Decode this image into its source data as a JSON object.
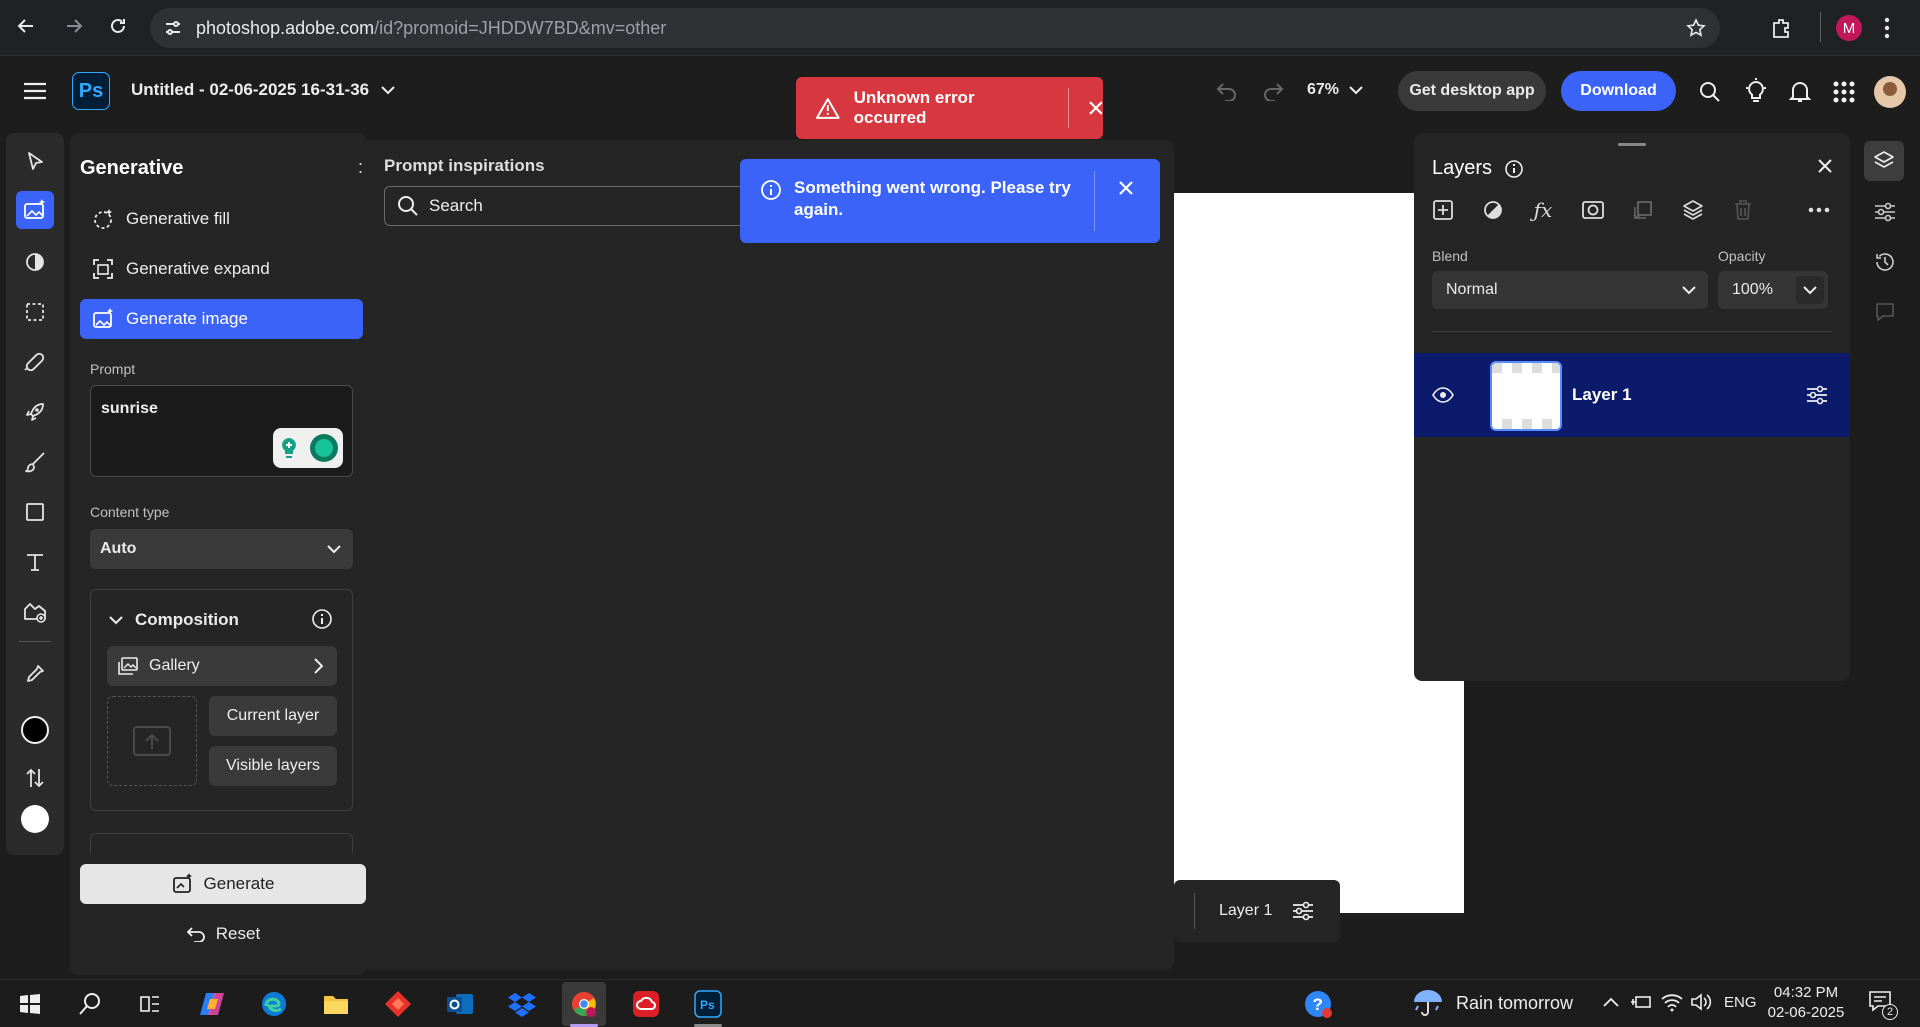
{
  "browser": {
    "url_host": "photoshop.adobe.com",
    "url_path": "/id?promoid=JHDDW7BD&mv=other",
    "profile_initial": "M"
  },
  "header": {
    "app_logo": "Ps",
    "doc_title": "Untitled - 02-06-2025 16-31-36",
    "zoom": "67%",
    "get_desktop_label": "Get desktop app",
    "download_label": "Download"
  },
  "toasts": {
    "error_text": "Unknown error occurred",
    "info_text_line1": "Something went wrong. Please try",
    "info_text_line2": "again."
  },
  "generative": {
    "title": "Generative",
    "options": [
      {
        "label": "Generative fill"
      },
      {
        "label": "Generative expand"
      },
      {
        "label": "Generate image"
      }
    ],
    "prompt_label": "Prompt",
    "prompt_value": "sunrise",
    "content_type_label": "Content type",
    "content_type_value": "Auto",
    "composition_label": "Composition",
    "gallery_label": "Gallery",
    "current_layer_label": "Current layer",
    "visible_layers_label": "Visible layers",
    "generate_label": "Generate",
    "reset_label": "Reset"
  },
  "inspirations": {
    "title": "Prompt inspirations",
    "search_placeholder": "Search"
  },
  "canvas": {
    "layer_chip_label": "Layer 1"
  },
  "layers": {
    "title": "Layers",
    "blend_label": "Blend",
    "blend_value": "Normal",
    "opacity_label": "Opacity",
    "opacity_value": "100%",
    "items": [
      {
        "name": "Layer 1"
      }
    ]
  },
  "taskbar": {
    "weather": "Rain tomorrow",
    "language": "ENG",
    "time": "04:32 PM",
    "date": "02-06-2025",
    "notifications": "2"
  },
  "colors": {
    "accent_blue": "#3c63f7",
    "error_red": "#d7373f",
    "selected_layer": "#0b1a6b"
  }
}
